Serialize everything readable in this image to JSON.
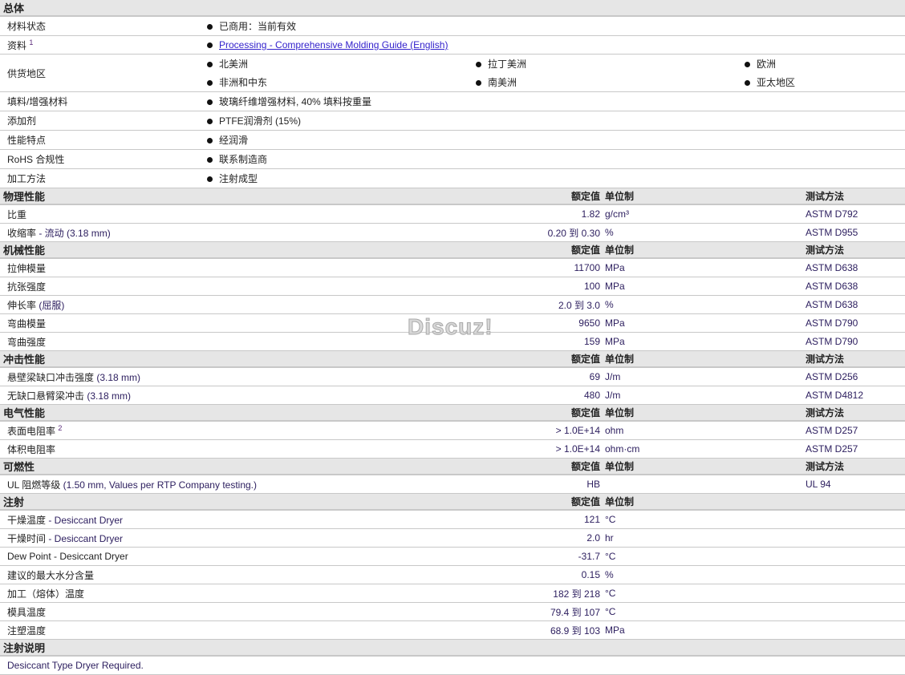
{
  "general": {
    "title": "总体",
    "rows": [
      {
        "label": "材料状态",
        "values": [
          "已商用：当前有效"
        ]
      },
      {
        "label": "资料",
        "sup": "1",
        "link": "Processing - Comprehensive Molding Guide (English)"
      },
      {
        "label": "供货地区",
        "values": [
          "北美洲",
          "拉丁美洲",
          "欧洲",
          "非洲和中东",
          "南美洲",
          "亚太地区"
        ]
      },
      {
        "label": "填料/增强材料",
        "values": [
          "玻璃纤维增强材料, 40% 填料按重量"
        ]
      },
      {
        "label": "添加剂",
        "values": [
          "PTFE润滑剂 (15%)"
        ]
      },
      {
        "label": "性能特点",
        "values": [
          "经润滑"
        ]
      },
      {
        "label": "RoHS 合规性",
        "values": [
          "联系制造商"
        ]
      },
      {
        "label": "加工方法",
        "values": [
          "注射成型"
        ]
      }
    ]
  },
  "headers": {
    "value": "额定值",
    "unit": "单位制",
    "test": "测试方法"
  },
  "sections": [
    {
      "title": "物理性能",
      "test": true,
      "rows": [
        {
          "label": "比重",
          "value": "1.82",
          "unit": "g/cm³",
          "test": "ASTM D792"
        },
        {
          "label": "收缩率",
          "note": " - 流动 (3.18 mm)",
          "value": "0.20 到 0.30",
          "unit": "%",
          "test": "ASTM D955"
        }
      ]
    },
    {
      "title": "机械性能",
      "test": true,
      "rows": [
        {
          "label": "拉伸模量",
          "value": "11700",
          "unit": "MPa",
          "test": "ASTM D638"
        },
        {
          "label": "抗张强度",
          "value": "100",
          "unit": "MPa",
          "test": "ASTM D638"
        },
        {
          "label": "伸长率",
          "note": " (屈服)",
          "value": "2.0 到 3.0",
          "unit": "%",
          "test": "ASTM D638"
        },
        {
          "label": "弯曲模量",
          "value": "9650",
          "unit": "MPa",
          "test": "ASTM D790"
        },
        {
          "label": "弯曲强度",
          "value": "159",
          "unit": "MPa",
          "test": "ASTM D790"
        }
      ]
    },
    {
      "title": "冲击性能",
      "test": true,
      "rows": [
        {
          "label": "悬壁梁缺口冲击强度",
          "note": " (3.18 mm)",
          "value": "69",
          "unit": "J/m",
          "test": "ASTM D256"
        },
        {
          "label": "无缺口悬臂梁冲击",
          "note": " (3.18 mm)",
          "value": "480",
          "unit": "J/m",
          "test": "ASTM D4812"
        }
      ]
    },
    {
      "title": "电气性能",
      "test": true,
      "rows": [
        {
          "label": "表面电阻率",
          "sup": "2",
          "value": "> 1.0E+14",
          "unit": "ohm",
          "test": "ASTM D257"
        },
        {
          "label": "体积电阻率",
          "value": "> 1.0E+14",
          "unit": "ohm·cm",
          "test": "ASTM D257"
        }
      ]
    },
    {
      "title": "可燃性",
      "test": true,
      "rows": [
        {
          "label": "UL 阻燃等级",
          "note": " (1.50 mm, Values per RTP Company testing.)",
          "value": "HB",
          "unit": "",
          "test": "UL 94"
        }
      ]
    },
    {
      "title": "注射",
      "test": false,
      "rows": [
        {
          "label": "干燥温度",
          "note": " - Desiccant Dryer",
          "value": "121",
          "unit": "°C",
          "test": ""
        },
        {
          "label": "干燥时间",
          "note": " - Desiccant Dryer",
          "value": "2.0",
          "unit": "hr",
          "test": ""
        },
        {
          "label": "Dew Point - Desiccant Dryer",
          "value": "-31.7",
          "unit": "°C",
          "test": ""
        },
        {
          "label": "建议的最大水分含量",
          "value": "0.15",
          "unit": "%",
          "test": ""
        },
        {
          "label": "加工（熔体）温度",
          "value": "182 到 218",
          "unit": "°C",
          "test": ""
        },
        {
          "label": "模具温度",
          "value": "79.4 到 107",
          "unit": "°C",
          "test": ""
        },
        {
          "label": "注塑温度",
          "value": "68.9 到 103",
          "unit": "MPa",
          "test": ""
        }
      ]
    }
  ],
  "notes": {
    "title": "注射说明",
    "text": "Desiccant Type Dryer Required."
  },
  "watermark": "Discuz!"
}
